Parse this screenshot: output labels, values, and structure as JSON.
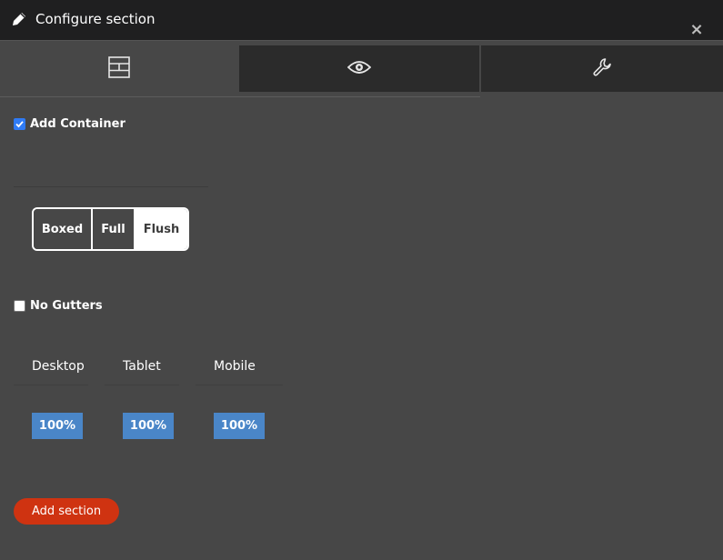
{
  "dialog": {
    "title": "Configure section",
    "close_label": "×"
  },
  "tabs": [
    {
      "icon": "layout-icon",
      "active": true
    },
    {
      "icon": "eye-icon",
      "active": false
    },
    {
      "icon": "wrench-icon",
      "active": false
    }
  ],
  "container": {
    "label": "Add Container",
    "checked": true
  },
  "width_options": {
    "options": [
      "Boxed",
      "Full",
      "Flush"
    ],
    "selected": "Flush"
  },
  "gutters": {
    "label": "No Gutters",
    "checked": false
  },
  "columns": [
    {
      "label": "Desktop",
      "value": "100%"
    },
    {
      "label": "Tablet",
      "value": "100%"
    },
    {
      "label": "Mobile",
      "value": "100%"
    }
  ],
  "actions": {
    "add_section_label": "Add section"
  },
  "colors": {
    "background": "#474747",
    "titlebar": "#1f1f20",
    "accent_blue": "#4a86c8",
    "primary_button": "#cf3311"
  }
}
